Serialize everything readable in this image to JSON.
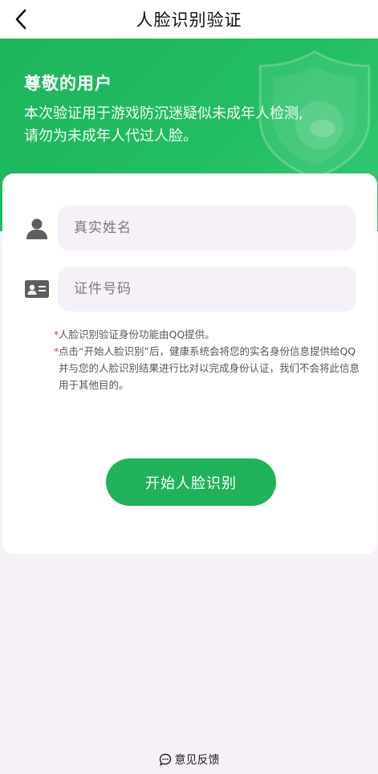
{
  "navbar": {
    "title": "人脸识别验证"
  },
  "banner": {
    "heading": "尊敬的用户",
    "line1": "本次验证用于游戏防沉迷疑似未成年人检测,",
    "line2": "请勿为未成年人代过人脸。"
  },
  "form": {
    "name_placeholder": "真实姓名",
    "id_placeholder": "证件号码"
  },
  "notes": [
    "人脸识别验证身份功能由QQ提供。",
    "点击“开始人脸识别”后，健康系统会将您的实名身份信息提供给QQ并与您的人脸识别结果进行比对以完成身份认证，我们不会将此信息用于其他目的。"
  ],
  "note_marker": "*",
  "start_button_label": "开始人脸识别",
  "feedback_label": "意见反馈",
  "colors": {
    "brand_green": "#1fb25a",
    "required_marker": "#e2403c"
  }
}
